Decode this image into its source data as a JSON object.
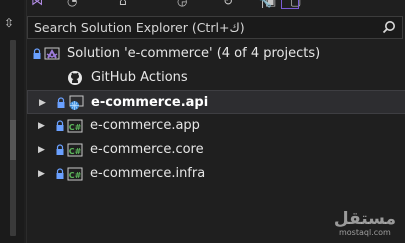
{
  "search": {
    "placeholder": "Search Solution Explorer (Ctrl+ك)"
  },
  "solution": {
    "label": "Solution 'e-commerce' (4 of 4 projects)",
    "github_label": "GitHub Actions",
    "projects": [
      {
        "label": "e-commerce.api",
        "bold": true,
        "icon": "web-project-icon"
      },
      {
        "label": "e-commerce.app",
        "bold": false,
        "icon": "csharp-project-icon"
      },
      {
        "label": "e-commerce.core",
        "bold": false,
        "icon": "csharp-project-icon"
      },
      {
        "label": "e-commerce.infra",
        "bold": false,
        "icon": "csharp-project-icon"
      }
    ]
  },
  "watermark": {
    "main": "مستقل",
    "sub": "mostaql.com"
  },
  "colors": {
    "lock": "#6aa0ff",
    "csharp": "#5db85b",
    "solution": "#9b7bd8",
    "web": "#3e8ede"
  }
}
